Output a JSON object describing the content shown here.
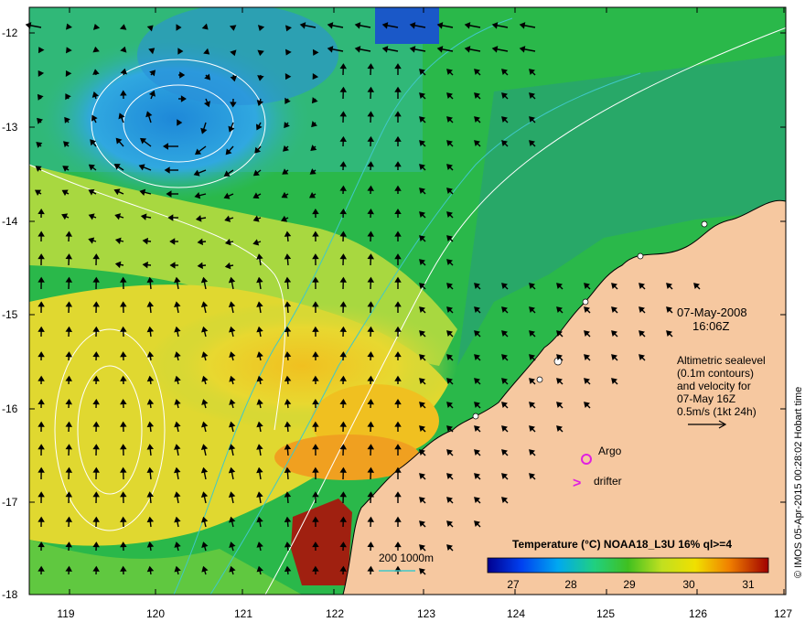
{
  "map": {
    "lat_ticks": [
      "-12",
      "-13",
      "-14",
      "-15",
      "-16",
      "-17",
      "-18"
    ],
    "lon_ticks": [
      "119",
      "120",
      "121",
      "122",
      "123",
      "124",
      "125",
      "126",
      "127"
    ],
    "colors": {
      "land": "#f6c8a0",
      "sst_cool": "#3aa0e0",
      "sst_mid": "#2ec050",
      "sst_warm": "#e8d020",
      "sst_hot": "#a01808",
      "contour": "#ffffff",
      "bathymetry": "#40c0c0",
      "arrow": "#000000",
      "marker": "#e020e0"
    }
  },
  "annotation": {
    "date": "07-May-2008",
    "time": "16:06Z",
    "desc_lines": [
      "Altimetric sealevel",
      "(0.1m contours)",
      "and velocity for",
      "07-May 16Z",
      "0.5m/s (1kt 24h)"
    ]
  },
  "legend": {
    "argo_label": "Argo",
    "drifter_label": "drifter",
    "drifter_symbol": ">",
    "bathymetry_label": "200  1000m"
  },
  "colorbar": {
    "title": "Temperature (°C) NOAA18_L3U 16% ql>=4",
    "ticks": [
      "27",
      "28",
      "29",
      "30",
      "31"
    ]
  },
  "credit": "© IMOS 05-Apr-2015 00:28:02 Hobart time"
}
